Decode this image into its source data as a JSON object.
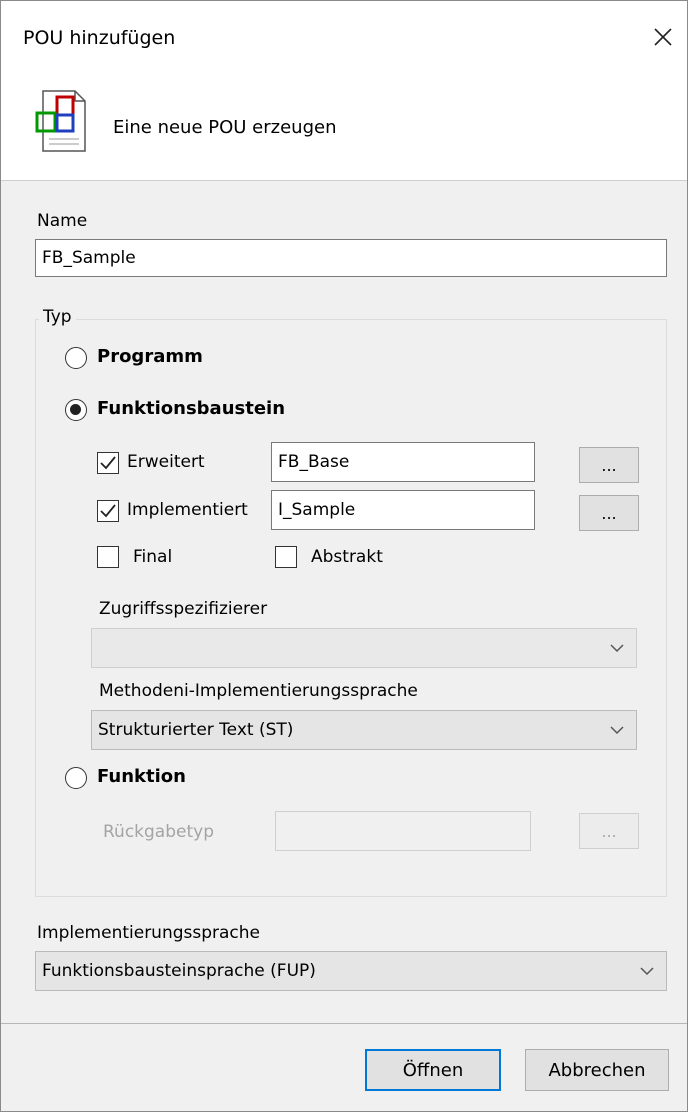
{
  "dialog": {
    "title": "POU hinzufügen",
    "header_text": "Eine neue POU erzeugen",
    "header_icon": "pou-icon"
  },
  "name_field": {
    "label": "Name",
    "value": "FB_Sample"
  },
  "type_group": {
    "title": "Typ",
    "options": {
      "program": {
        "label": "Programm",
        "selected": false
      },
      "function_block": {
        "label": "Funktionsbaustein",
        "selected": true
      },
      "function": {
        "label": "Funktion",
        "selected": false
      }
    },
    "extends": {
      "label": "Erweitert",
      "checked": true,
      "value": "FB_Base",
      "browse_label": "..."
    },
    "implements": {
      "label": "Implementiert",
      "checked": true,
      "value": "I_Sample",
      "browse_label": "..."
    },
    "final": {
      "label": "Final",
      "checked": false
    },
    "abstract": {
      "label": "Abstrakt",
      "checked": false
    },
    "access_specifier": {
      "label": "Zugriffsspezifizierer",
      "value": ""
    },
    "method_language": {
      "label": "Methodeni-Implementierungssprache",
      "value": "Strukturierter Text (ST)"
    },
    "return_type": {
      "label": "Rückgabetyp",
      "value": "",
      "browse_label": "..."
    }
  },
  "implementation_language": {
    "label": "Implementierungssprache",
    "value": "Funktionsbausteinsprache (FUP)"
  },
  "buttons": {
    "open": "Öffnen",
    "cancel": "Abbrechen"
  }
}
